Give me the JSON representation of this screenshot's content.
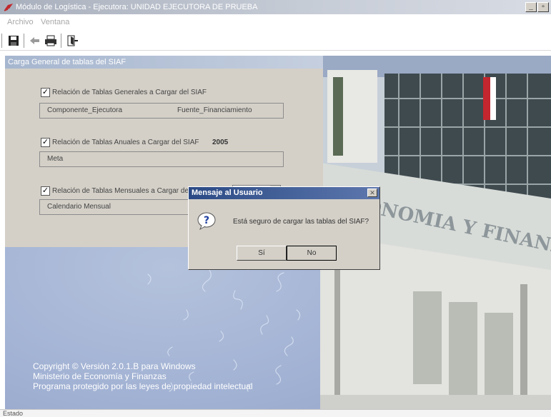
{
  "window": {
    "title": "Módulo de Logística - Ejecutora: UNIDAD EJECUTORA DE PRUEBA",
    "minimize": "_",
    "maximize": "▫"
  },
  "menu": {
    "archivo": "Archivo",
    "ventana": "Ventana"
  },
  "toolbar": {
    "icons": [
      "save-icon",
      "back-icon",
      "print-icon",
      "exit-icon"
    ]
  },
  "panel": {
    "title": "Carga General de tablas del SIAF",
    "generales": {
      "label": "Relación de Tablas Generales a Cargar del SIAF",
      "checked": true,
      "items": [
        "Componente_Ejecutora",
        "Fuente_Financiamiento"
      ]
    },
    "anuales": {
      "label": "Relación de Tablas Anuales a Cargar del SIAF",
      "checked": true,
      "year": "2005",
      "items": [
        "Meta"
      ]
    },
    "mensuales": {
      "label": "Relación de Tablas Mensuales a Cargar del SIAF",
      "checked": true,
      "items": [
        "Calendario Mensual"
      ]
    }
  },
  "footer": {
    "line1": "Copyright © Versión 2.0.1.B  para Windows",
    "line2": "Ministerio de Economía y Finanzas",
    "line3": "Programa  protegido  por  las  leyes  de  propiedad  intelectual"
  },
  "dialog": {
    "title": "Mensaje al Usuario",
    "close": "✕",
    "message": "Está seguro de cargar las tablas del SIAF?",
    "yes": "Sí",
    "no": "No"
  },
  "status": {
    "text": "Estado"
  },
  "photo": {
    "sign_text": "ECONOMIA Y FINANZAS"
  },
  "colors": {
    "dialog_title": "#2b4a85",
    "panel": "#d4d0c8",
    "background": "#a1b1d3"
  }
}
